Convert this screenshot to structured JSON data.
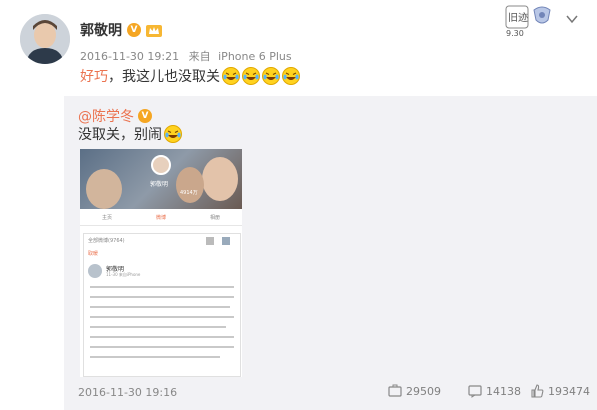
{
  "post": {
    "author": "郭敬明",
    "timestamp": "2016-11-30 19:21",
    "source_prefix": "来自",
    "source": "iPhone 6 Plus",
    "text_highlight": "好巧",
    "text_rest": "，我这儿也没取关",
    "emoji_count": 4,
    "badge_text": "9.30",
    "badge_label": "旧迹"
  },
  "repost": {
    "author": "@陈学冬",
    "text": "没取关，别闹",
    "timestamp": "2016-11-30 19:16",
    "actions": {
      "forward_count": "29509",
      "comment_count": "14138",
      "like_count": "193474"
    },
    "screenshot": {
      "banner_name": "郭敬明",
      "banner_stats": "4914万",
      "tabs": [
        "主页",
        "微博",
        "相册"
      ],
      "card_header": "全部微博(9764)",
      "card_author": "郭敬明",
      "card_meta": "11-30 来自iPhone",
      "card_highlight": "取暖"
    }
  },
  "colors": {
    "accent": "#eb7350",
    "vip_orange": "#f5a623",
    "repost_bg": "#f2f2f5",
    "meta_gray": "#888888"
  }
}
